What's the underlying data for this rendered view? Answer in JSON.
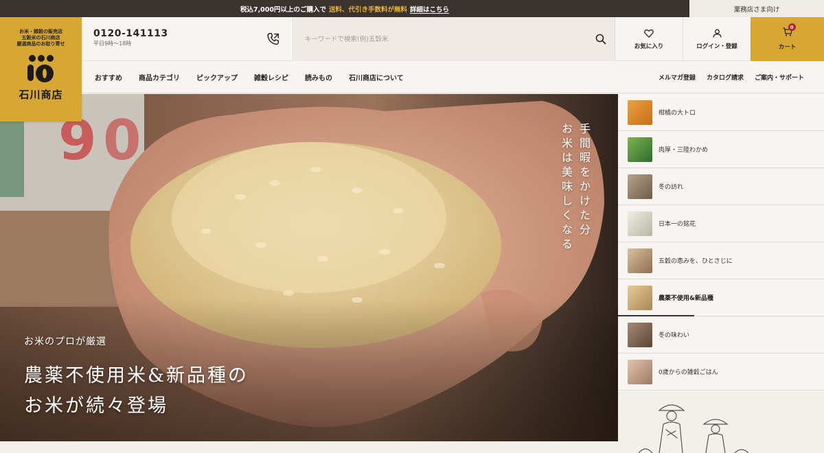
{
  "topbar": {
    "msg_pre": "税込7,000円以上のご購入で",
    "msg_highlight": "送料、代引き手数料が無料",
    "msg_detail": "詳細はこちら",
    "business_link": "業務店さま向け"
  },
  "logo": {
    "tagline_1": "お米・雑穀の販売店",
    "tagline_2": "五穀米の石川商店",
    "tagline_3": "厳選商品のお取り寄せ",
    "name": "石川商店",
    "icon": "rice-mark-logo"
  },
  "header": {
    "phone_number": "0120-141113",
    "phone_hours": "平日9時～18時",
    "phone_icon": "phone-icon",
    "search_placeholder": "キーワードで検索(例)五穀米",
    "search_icon": "search-icon",
    "favorites_label": "お気に入り",
    "login_label": "ログイン・登録",
    "cart_label": "カート",
    "cart_count": "0"
  },
  "nav": {
    "left": [
      "おすすめ",
      "商品カテゴリ",
      "ピックアップ",
      "雑穀レシピ",
      "読みもの",
      "石川商店について"
    ],
    "right": [
      "メルマガ登録",
      "カタログ請求",
      "ご案内・サポート"
    ]
  },
  "hero": {
    "vertical_1": "手間暇をかけた分",
    "vertical_2": "お米は美味しくなる",
    "eyebrow": "お米のプロが厳選",
    "title_1": "農薬不使用米&新品種の",
    "title_2": "お米が続々登場"
  },
  "side_items": [
    {
      "label": "柑橘の大トロ",
      "active": false,
      "thumb": "#d88a2a"
    },
    {
      "label": "肉厚・三陸わかめ",
      "active": false,
      "thumb": "#4f8a3a"
    },
    {
      "label": "冬の訪れ",
      "active": false,
      "thumb": "#a08a72"
    },
    {
      "label": "日本一の銘花",
      "active": false,
      "thumb": "#d8d6c8"
    },
    {
      "label": "五穀の恵みを、ひとさじに",
      "active": false,
      "thumb": "#b89a78"
    },
    {
      "label": "農薬不使用&新品種",
      "active": true,
      "thumb": "#c7a878"
    },
    {
      "label": "冬の味わい",
      "active": false,
      "thumb": "#8a6e5a"
    },
    {
      "label": "0歳からの雑穀ごはん",
      "active": false,
      "thumb": "#c8a892"
    }
  ],
  "colors": {
    "accent": "#d6a735",
    "topbar_bg": "#3a3330",
    "highlight": "#e6b43a",
    "badge": "#b3262b"
  }
}
